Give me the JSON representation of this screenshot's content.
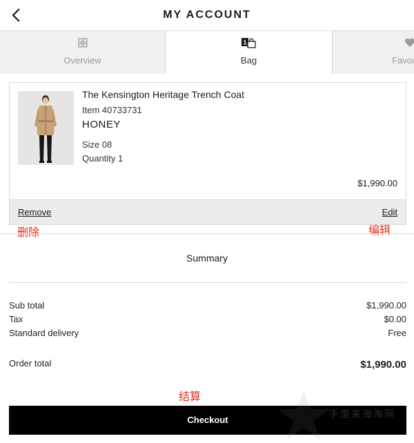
{
  "header": {
    "title": "MY ACCOUNT"
  },
  "tabs": [
    {
      "label": "Overview",
      "icon": "grid-icon"
    },
    {
      "label": "Bag",
      "icon": "bag-icon",
      "badge": "1"
    },
    {
      "label": "Favou",
      "icon": "heart-icon"
    }
  ],
  "item": {
    "name": "The Kensington Heritage Trench Coat",
    "number": "Item 40733731",
    "color": "HONEY",
    "size": "Size 08",
    "quantity": "Quantity 1",
    "price": "$1,990.00",
    "remove_label": "Remove",
    "edit_label": "Edit"
  },
  "annotations": {
    "remove": "删除",
    "edit": "编辑",
    "checkout": "结算"
  },
  "summary": {
    "title": "Summary",
    "subtotal_label": "Sub total",
    "subtotal_value": "$1,990.00",
    "tax_label": "Tax",
    "tax_value": "$0.00",
    "delivery_label": "Standard delivery",
    "delivery_value": "Free",
    "total_label": "Order total",
    "total_value": "$1,990.00"
  },
  "checkout_label": "Checkout",
  "watermark": {
    "text": "手里来海淘网"
  },
  "colors": {
    "annotation": "#e0301e",
    "button": "#000000",
    "tab_inactive": "#f0f0f0"
  }
}
